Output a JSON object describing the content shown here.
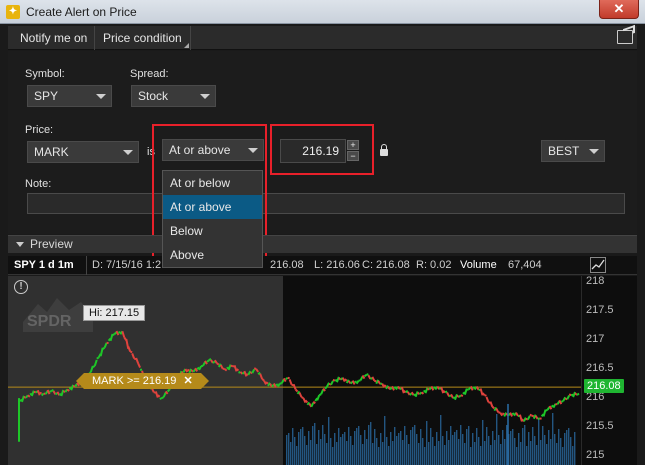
{
  "window": {
    "title": "Create Alert on Price",
    "close_label": "✕"
  },
  "header": {
    "tab1": "Notify me on",
    "tab2": "Price condition"
  },
  "form": {
    "symbol_label": "Symbol:",
    "symbol_value": "SPY",
    "spread_label": "Spread:",
    "spread_value": "Stock",
    "price_label": "Price:",
    "price_type_value": "MARK",
    "is_label": "is",
    "condition_value": "At or above",
    "price_value": "216.19",
    "spin_up": "+",
    "spin_down": "−",
    "order_type_value": "BEST",
    "note_label": "Note:",
    "note_value": ""
  },
  "condition_options": [
    "At or below",
    "At or above",
    "Below",
    "Above"
  ],
  "condition_selected_index": 1,
  "preview": {
    "label": "Preview"
  },
  "chart_header": {
    "symbol": "SPY 1 d 1m",
    "date": "D: 7/15/16 1:2",
    "close_visible": "216.08",
    "low": "L: 216.06",
    "close": "C: 216.08",
    "range": "R: 0.02",
    "volume_label": "Volume",
    "volume_value": "67,404"
  },
  "chart": {
    "alert_glyph": "!",
    "watermark": "SPDR",
    "hi_label": "Hi: 217.15",
    "mark_label": "MARK >= 216.19",
    "mark_close": "✕",
    "current_price": "216.08"
  },
  "chart_data": {
    "type": "line",
    "yticks": [
      "218",
      "217.5",
      "217",
      "216.5",
      "216",
      "215.5",
      "215"
    ],
    "ylim": [
      214.85,
      218.1
    ],
    "alert_level": 216.19,
    "current_price": 216.08,
    "hi": 217.15,
    "up_color": "#1ec728",
    "down_color": "#e0433d",
    "volume_color": "#2b6fa8",
    "series": [
      {
        "values": [
          215.95,
          216.05,
          216.1,
          216.08,
          216.12,
          216.05,
          216.15,
          216.2,
          216.3,
          216.45,
          216.7,
          216.95,
          217.1,
          217.15,
          216.8,
          216.6,
          216.3,
          216.1,
          216.0,
          216.15,
          216.35,
          216.5,
          216.45,
          216.55,
          216.65,
          216.6,
          216.5,
          216.55,
          216.45,
          216.4,
          216.5,
          216.3,
          216.2,
          216.25,
          216.35,
          216.15,
          216.0,
          215.85,
          216.05,
          216.2,
          216.3,
          216.35,
          216.25,
          216.3,
          216.4,
          216.3,
          216.25,
          216.15,
          216.2,
          216.1,
          216.05,
          216.1,
          216.15,
          216.2,
          216.1,
          216.0,
          216.05,
          216.15,
          216.2,
          216.05,
          215.85,
          215.75,
          215.7,
          215.75,
          215.6,
          215.7,
          215.65,
          215.8,
          215.9,
          215.95,
          216.05,
          216.08
        ]
      }
    ]
  },
  "colors": {
    "accent": "#0b5a85",
    "highlight_box": "#e8202a",
    "mark_tag": "#b58a1a",
    "price_badge": "#1fb531"
  }
}
